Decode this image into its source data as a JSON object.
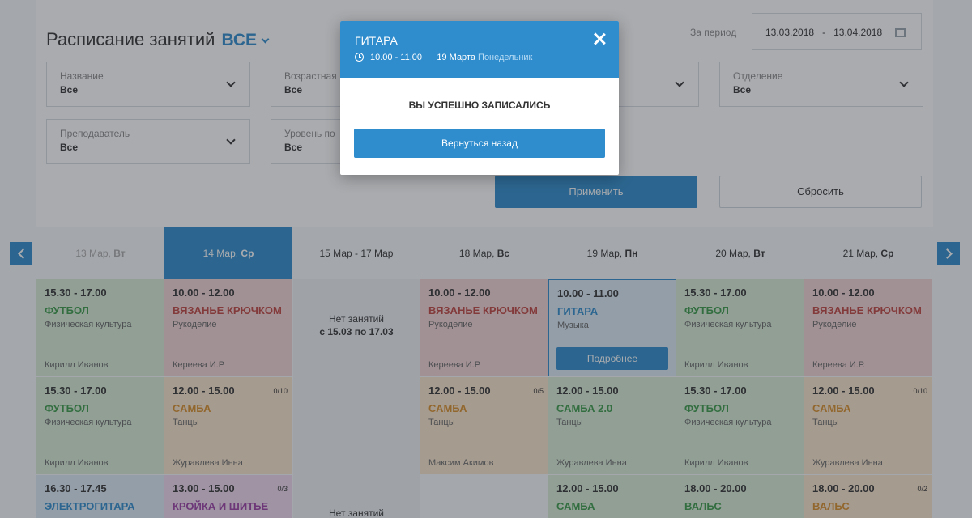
{
  "header": {
    "title": "Расписание занятий",
    "all_label": "ВСЕ",
    "period_label": "За период",
    "date_from": "13.03.2018",
    "date_to": "13.04.2018"
  },
  "filters": [
    {
      "label": "Название",
      "value": "Все"
    },
    {
      "label": "Возрастная",
      "value": "Все"
    },
    {
      "label": "",
      "value": ""
    },
    {
      "label": "Отделение",
      "value": "Все"
    },
    {
      "label": "Преподаватель",
      "value": "Все"
    },
    {
      "label": "Уровень по",
      "value": "Все"
    }
  ],
  "buttons": {
    "apply": "Применить",
    "reset": "Сбросить"
  },
  "days": [
    {
      "date": "13 Мар,",
      "weekday": "Вт"
    },
    {
      "date": "14 Мар,",
      "weekday": "Ср"
    },
    {
      "date": "15 Мар - 17 Мар",
      "weekday": ""
    },
    {
      "date": "18 Мар,",
      "weekday": "Вс"
    },
    {
      "date": "19 Мар,",
      "weekday": "Пн"
    },
    {
      "date": "20 Мар,",
      "weekday": "Вт"
    },
    {
      "date": "21 Мар,",
      "weekday": "Ср"
    }
  ],
  "no_lessons": {
    "text": "Нет занятий",
    "range": "с 15.03 по 17.03"
  },
  "lessons": [
    {
      "time": "15.30 - 17.00",
      "name": "ФУТБОЛ",
      "category": "Физическая культура",
      "teacher": "Кирилл Иванов",
      "count": ""
    },
    {
      "time": "15.30 - 17.00",
      "name": "ФУТБОЛ",
      "category": "Физическая культура",
      "teacher": "Кирилл Иванов",
      "count": ""
    },
    {
      "time": "16.30 - 17.45",
      "name": "ЭЛЕКТРОГИТАРА",
      "category": "",
      "teacher": "",
      "count": ""
    },
    {
      "time": "10.00 - 12.00",
      "name": "ВЯЗАНЬЕ КРЮЧКОМ",
      "category": "Рукоделие",
      "teacher": "Кереева И.Р.",
      "count": ""
    },
    {
      "time": "12.00 - 15.00",
      "name": "САМБА",
      "category": "Танцы",
      "teacher": "Журавлева Инна",
      "count": "0/10"
    },
    {
      "time": "13.00 - 15.00",
      "name": "КРОЙКА И ШИТЬЕ",
      "category": "",
      "teacher": "",
      "count": "0/3"
    },
    {
      "time": "10.00 - 12.00",
      "name": "ВЯЗАНЬЕ КРЮЧКОМ",
      "category": "Рукоделие",
      "teacher": "Кереева И.Р.",
      "count": ""
    },
    {
      "time": "12.00 - 15.00",
      "name": "САМБА",
      "category": "Танцы",
      "teacher": "Максим Акимов",
      "count": "0/5"
    },
    {
      "time": "10.00 - 11.00",
      "name": "ГИТАРА",
      "category": "Музыка",
      "teacher": "",
      "count": ""
    },
    {
      "time": "12.00 - 15.00",
      "name": "САМБА 2.0",
      "category": "Танцы",
      "teacher": "Журавлева Инна",
      "count": ""
    },
    {
      "time": "12.00 - 15.00",
      "name": "САМБА",
      "category": "",
      "teacher": "",
      "count": ""
    },
    {
      "time": "15.30 - 17.00",
      "name": "ФУТБОЛ",
      "category": "Физическая культура",
      "teacher": "Кирилл Иванов",
      "count": ""
    },
    {
      "time": "15.30 - 17.00",
      "name": "ФУТБОЛ",
      "category": "Физическая культура",
      "teacher": "Кирилл Иванов",
      "count": ""
    },
    {
      "time": "18.00 - 20.00",
      "name": "ВАЛЬС",
      "category": "",
      "teacher": "",
      "count": ""
    },
    {
      "time": "10.00 - 12.00",
      "name": "ВЯЗАНЬЕ КРЮЧКОМ",
      "category": "Рукоделие",
      "teacher": "Кереева И.Р.",
      "count": ""
    },
    {
      "time": "12.00 - 15.00",
      "name": "САМБА",
      "category": "Танцы",
      "teacher": "Журавлева Инна",
      "count": "0/10"
    },
    {
      "time": "18.00 - 20.00",
      "name": "ВАЛЬС",
      "category": "",
      "teacher": "",
      "count": "0/2"
    }
  ],
  "more_label": "Подробнее",
  "modal": {
    "title": "ГИТАРА",
    "time": "10.00  -  11.00",
    "date": "19 Марта",
    "weekday": "Понедельник",
    "message": "ВЫ УСПЕШНО ЗАПИСАЛИСЬ",
    "back_label": "Вернуться назад"
  },
  "colors": {
    "accent": "#2f8ccd",
    "green": "#3a9a48",
    "red": "#c0433f",
    "orange": "#d98e2b",
    "purple": "#9b3fa5"
  },
  "icons": [
    "chevron-down-icon",
    "calendar-icon",
    "chevron-left-icon",
    "chevron-right-icon",
    "clock-icon",
    "close-icon"
  ]
}
